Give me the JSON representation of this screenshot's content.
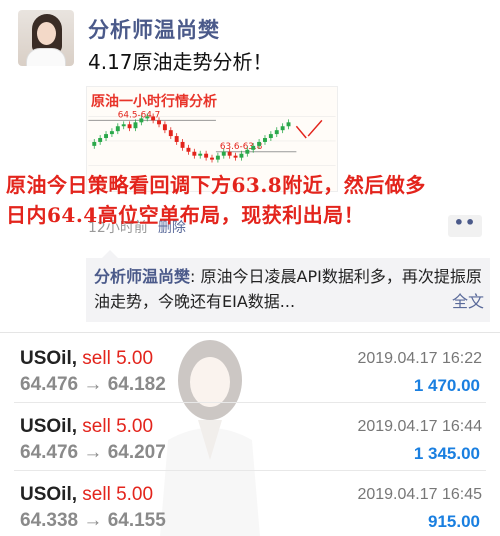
{
  "post": {
    "author": "分析师温尚樊",
    "text": "4.17原油走势分析！",
    "time_ago": "12小时前",
    "delete_label": "删除",
    "more_label": "••"
  },
  "chart_image": {
    "title": "原油一小时行情分析",
    "upper_label": "64.5-64.7",
    "lower_label": "63.6-63.8"
  },
  "overlay": {
    "line1": "原油今日策略看回调下方63.8附近，然后做多",
    "line2": "日内64.4高位空单布局，现获利出局！"
  },
  "comment": {
    "name": "分析师温尚樊",
    "separator": ": ",
    "text": "原油今日凌晨API数据利多，再次提振原油走势，今晚还有EIA数据...",
    "full_text_label": "全文"
  },
  "trades": [
    {
      "symbol": "USOil,",
      "side": "sell 5.00",
      "open": "64.476",
      "arrow": "→",
      "close": "64.182",
      "time": "2019.04.17 16:22",
      "profit": "1 470.00"
    },
    {
      "symbol": "USOil,",
      "side": "sell 5.00",
      "open": "64.476",
      "arrow": "→",
      "close": "64.207",
      "time": "2019.04.17 16:44",
      "profit": "1 345.00"
    },
    {
      "symbol": "USOil,",
      "side": "sell 5.00",
      "open": "64.338",
      "arrow": "→",
      "close": "64.155",
      "time": "2019.04.17 16:45",
      "profit": "915.00"
    }
  ],
  "colors": {
    "accent_red": "#e3241c",
    "author_blue": "#4b5a8a",
    "profit_blue": "#1a7fe0"
  }
}
